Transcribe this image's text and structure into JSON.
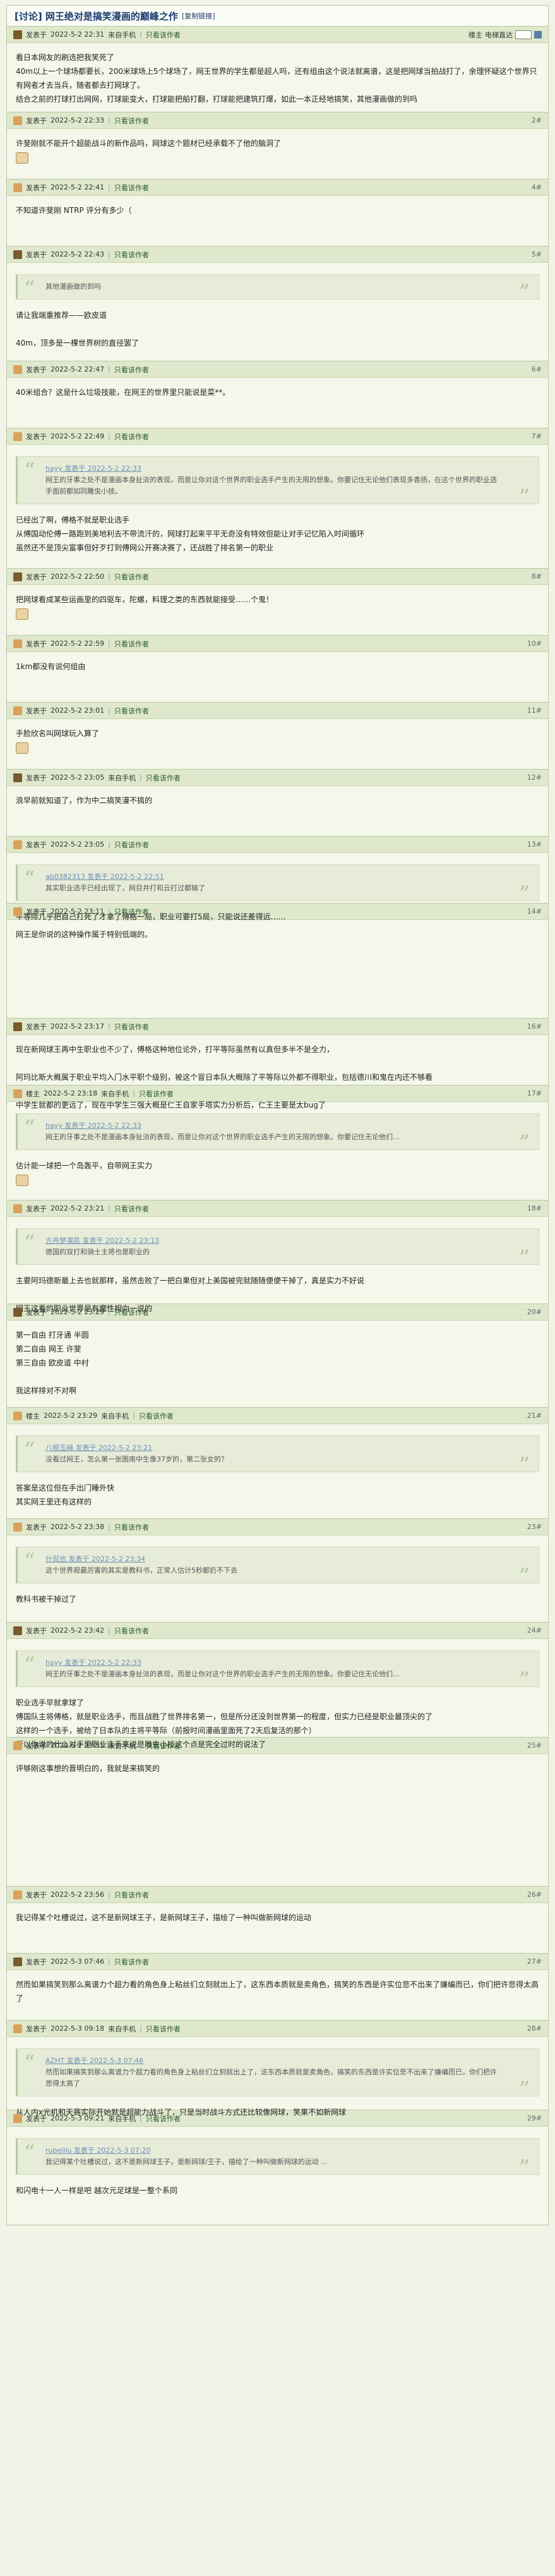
{
  "thread": {
    "title": "[讨论] 网王绝对是搞笑漫画的巅峰之作",
    "copy_link": "[复制链接]"
  },
  "labels": {
    "only_op": "只看该作者",
    "mobile": "来自手机",
    "font_size": "电梯直达",
    "jump": "楼主"
  },
  "posts": [
    {
      "author": "发表于",
      "date": "2022-5-2 22:31",
      "mobile": true,
      "floor": "楼主",
      "body": "看日本网友的刷选把我笑死了\n40m以上一个球场都要长，200米球场上5个球场了，网王世界的学生都是超人吗，还有组由这个说法就离谱，这是把网球当拍战打了，余理怀疑这个世界只有网者才去当兵，随者都去打网球了。\n结合之前的打球打出网网，打球能变大，打球能把船打翻，打球能把建筑打爆，如此一本正经地搞笑，其他漫画做的到吗"
    },
    {
      "author": "发表于",
      "date": "2022-5-2 22:33",
      "floor": "2#",
      "body": "许斐刚就不能开个超能战斗的新作品吗，网球这个题材已经承载不了他的脑洞了"
    },
    {
      "author": "发表于",
      "date": "2022-5-2 22:41",
      "floor": "4#",
      "body": "不知道许斐刚 NTRP 评分有多少（"
    },
    {
      "author": "发表于",
      "date": "2022-5-2 22:43",
      "floor": "5#",
      "quote_head": "",
      "quote": "其他漫画做的到吗",
      "body": "请让我端重推荐——欧皮道\n\n40m，顶多是一棵世界树的直径罢了"
    },
    {
      "author": "发表于",
      "date": "2022-5-2 22:47",
      "floor": "6#",
      "body": "40米组合？这是什么垃圾技能，在网王的世界里只能说是菜**。"
    },
    {
      "author": "发表于",
      "date": "2022-5-2 22:49",
      "floor": "7#",
      "quote_head": "hayy 发表于 2022-5-2 22:33",
      "quote": "网王的牙事之处不是漫画本身扯淡的表现，而是让你对这个世界的职业选手产生的无限的想象。你要记住无论他们表现多香扬，在这个世界的职业选手面前都如同雕虫小技。",
      "body": "已经出了啊，傅格不就是职业选手\n从傅国动伦傅一路跑到美地利去不带流汗的，网球打起来平平无奇没有特效但能让对手记忆陷入时间循环\n虽然还不是顶尖富事但好歹打到傅网公开赛决赛了，还战胜了排名第一的职业"
    },
    {
      "author": "发表于",
      "date": "2022-5-2 22:50",
      "floor": "8#",
      "body": "把网球看成某些运画里的四驱车，陀螺，料理之类的东西就能接受……个鬼！"
    },
    {
      "author": "发表于",
      "date": "2022-5-2 22:59",
      "floor": "10#",
      "body": "1km都没有说何组由"
    },
    {
      "author": "发表于",
      "date": "2022-5-2 23:01",
      "floor": "11#",
      "body": "手脸欣名叫网球玩入算了"
    },
    {
      "author": "发表于",
      "date": "2022-5-2 23:05",
      "mobile": true,
      "floor": "12#",
      "body": "浪早前就知道了，作为中二搞笑漫不搞的"
    },
    {
      "author": "发表于",
      "date": "2022-5-2 23:05",
      "floor": "13#",
      "quote_head": "ab0382313 发表于 2022-5-2 22:51",
      "quote": "其实职业选手已经出现了，网目井打和云打过都输了",
      "body": "平等际几乎把自己打死了才拿了傅格一局，职业可要打5局，只能说还差得远……"
    },
    {
      "author": "发表于",
      "date": "2022-5-2 23:11",
      "floor": "14#",
      "body": "网王是你说的这种操作属于特别低端的。"
    },
    {
      "author": "发表于",
      "date": "2022-5-2 23:17",
      "floor": "16#",
      "body": "现在新网球王再中生职业也不少了，傅格这种地位论外，打平等际虽然有以真但多半不是全力，\n\n阿玛比斯大概属于职业平均入门水平职个级别，被这个冒日本队大概除了平等际以外都不得职业，包括德川和鬼在内还不够看\n\n中学生就都的更远了，现在中学生三强大概是仁王自家手塔实力分析后，仁王主要是太bug了"
    },
    {
      "author": "楼主",
      "date": "2022-5-2 23:18",
      "mobile": true,
      "floor": "17#",
      "quote_head": "hayy 发表于 2022-5-2 22:33",
      "quote": "网王的牙事之处不是漫画本身扯淡的表现，而是让你对这个世界的职业选手产生的无限的想象。你要记住无论他们...",
      "body": "估计能一球把一个岛轰平，自带网王实力"
    },
    {
      "author": "发表于",
      "date": "2022-5-2 23:21",
      "floor": "18#",
      "quote_head": "方舟梦凛凯 发表于 2022-5-2 23:13",
      "quote": "德国的双打和骑士主将也是职业的",
      "body": "主要阿玛德斯最上去也就那样，虽然击败了一把白果但对上美国被完就随随便便干掉了，真是实力不好说\n\n网王这看的职业世界是有魔性相向一说的"
    },
    {
      "author": "发表于",
      "date": "2022-5-2 23:29",
      "floor": "20#",
      "body": "第一自由 打牙通 半圆\n第二自由 网王 许斐\n第三自由 欧皮道 中村\n\n我这样排对不对啊"
    },
    {
      "author": "楼主",
      "date": "2022-5-2 23:29",
      "mobile": true,
      "floor": "21#",
      "quote_head": "八顿玉绳 发表于 2022-5-2 23:21",
      "quote": "没看过网王，怎么第一张图南中生像37岁的，第二张女的？",
      "body": "答案是这位但在手出门睡外快\n其实网王里还有这样的"
    },
    {
      "author": "发表于",
      "date": "2022-5-2 23:38",
      "floor": "23#",
      "quote_head": "什侃也 发表于 2022-5-2 23:34",
      "quote": "这个世界观最厉害的其实是教科书，正常人估计5秒都扔不下去",
      "body": "教科书被干掉过了"
    },
    {
      "author": "发表于",
      "date": "2022-5-2 23:42",
      "floor": "24#",
      "quote_head": "hayy 发表于 2022-5-2 22:33",
      "quote": "网王的牙事之处不是漫画本身扯淡的表现，而是让你对这个世界的职业选手产生的无限的想象。你要记住无论他们...",
      "body": "职业选手早就拿球了\n傅国队主将傅格，就是职业选手，而且战胜了世界排名第一，但是所分还没到世界第一的程度，但实力已经是职业最顶尖的了\n这样的一个选手，被给了日本队的主将平等际（前报时间漫画里面死了2天后复活的那个）\n所以你说的什么对手里职业选手来说是雕虫小技这个点是完全过时的说法了"
    },
    {
      "author": "发表于",
      "date": "2022-5-2 23:51",
      "mobile": true,
      "floor": "25#",
      "body": "评够刚这事想的晋明白的，我就是来搞笑的"
    },
    {
      "author": "发表于",
      "date": "2022-5-2 23:56",
      "floor": "26#",
      "body": "我记得某个吐槽说过，这不是新网球王子，是新网球王子，描绘了一种叫做新网球的运动"
    },
    {
      "author": "发表于",
      "date": "2022-5-3 07:46",
      "floor": "27#",
      "body": "然而如果搞笑到那么离谱力个超力看的角色身上粘丝们立刻就出上了，这东西本质就是卖角色，搞笑的东西是许实位悲不出来了嫌编而已，你们把许悲得太高了"
    },
    {
      "author": "发表于",
      "date": "2022-5-3 09:18",
      "mobile": true,
      "floor": "28#",
      "quote_head": "AZHT 发表于 2022-5-3 07:46",
      "quote": "然而如果搞笑到那么离谱力个超力看的角色身上粘丝们立刻就出上了，这东西本质就是卖角色，搞笑的东西是许实位悲不出来了嫌编而已，你们把许悲得太高了",
      "body": "从人内x光机和天赛实际开始就是超能力战斗了，只是当时战斗方式还比较像网球，笑果不如新网球"
    },
    {
      "author": "发表于",
      "date": "2022-5-3 09:21",
      "mobile": true,
      "floor": "29#",
      "quote_head": "rubeillu 发表于 2022-5-3 07:20",
      "quote": "我记得某个吐槽说过，这不是新网球王子，是新网球/王子，描绘了一种叫做新网球的运动 ...",
      "body": "和闪电十一人一样是吧 越次元足球是一整个系同"
    }
  ]
}
